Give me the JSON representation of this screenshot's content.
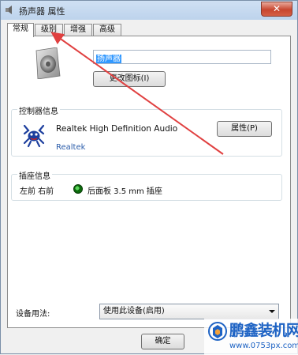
{
  "window": {
    "title": "扬声器 属性",
    "close_glyph": "✕"
  },
  "tabs": [
    {
      "label": "常规",
      "active": true
    },
    {
      "label": "级别",
      "active": false
    },
    {
      "label": "增强",
      "active": false
    },
    {
      "label": "高级",
      "active": false
    }
  ],
  "general": {
    "device_name_value": "扬声器",
    "change_icon_label": "更改图标(I)"
  },
  "controller": {
    "group_title": "控制器信息",
    "driver_name": "Realtek High Definition Audio",
    "vendor": "Realtek",
    "properties_label": "属性(P)"
  },
  "jack": {
    "group_title": "插座信息",
    "channel_label": "左前 右前",
    "description": "后面板 3.5 mm 插座"
  },
  "usage": {
    "label": "设备用法:",
    "selected": "使用此设备(启用)"
  },
  "footer": {
    "ok_label": "确定"
  },
  "watermark": {
    "brand": "鹏鑫装机网",
    "url": "www.0753px.com"
  },
  "colors": {
    "annotation_arrow": "#e04040",
    "jack_green": "#22a022",
    "watermark_blue": "#1e63c4"
  },
  "icons": {
    "speaker": "speaker-icon",
    "controller": "realtek-crab-icon",
    "jack": "green-jack-icon"
  }
}
